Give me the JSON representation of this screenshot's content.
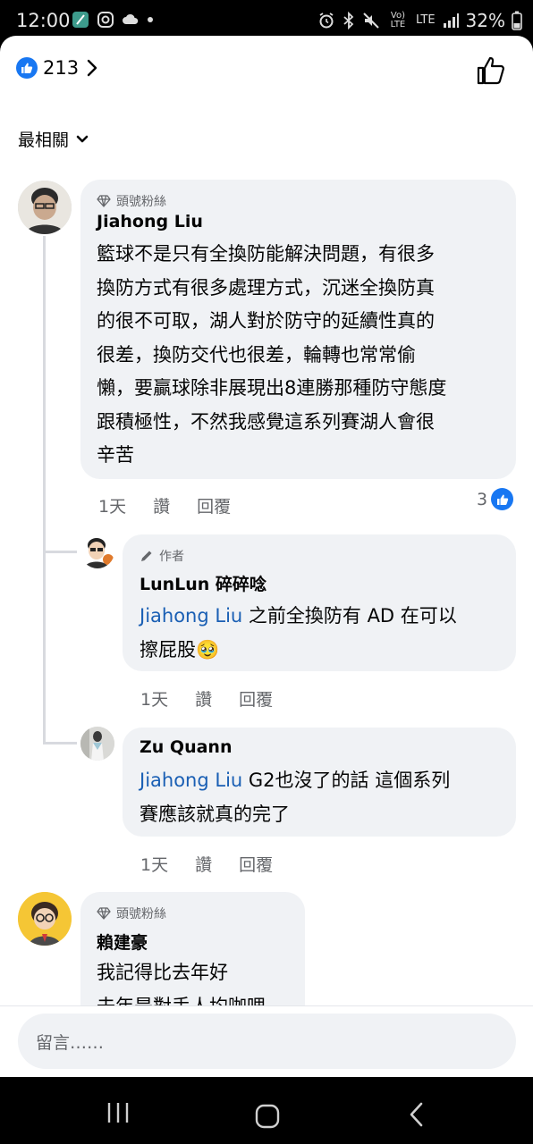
{
  "status_bar": {
    "time": "12:00",
    "battery": "32%",
    "volte": "Vo) LTE",
    "lte": "LTE"
  },
  "header": {
    "likes_count": "213"
  },
  "sort": {
    "label": "最相關"
  },
  "comments": [
    {
      "badge": "頭號粉絲",
      "author": "Jiahong Liu",
      "text_lines": [
        "籃球不是只有全換防能解決問題，有很多",
        "換防方式有很多處理方式，沉迷全換防真",
        "的很不可取，湖人對於防守的延續性真的",
        "很差，換防交代也很差，輪轉也常常偷",
        "懶，要贏球除非展現出8連勝那種防守態度",
        "跟積極性，不然我感覺這系列賽湖人會很",
        "辛苦"
      ],
      "time": "1天",
      "like": "讚",
      "reply": "回覆",
      "reactions": "3"
    },
    {
      "badge": "作者",
      "author": "LunLun 碎碎唸",
      "mention": "Jiahong Liu",
      "text_line1": " 之前全換防有 AD 在可以",
      "text_line2": "擦屁股🥹",
      "time": "1天",
      "like": "讚",
      "reply": "回覆"
    },
    {
      "author": "Zu Quann",
      "mention": "Jiahong Liu",
      "text_line1": " G2也沒了的話 這個系列",
      "text_line2": "賽應該就真的完了",
      "time": "1天",
      "like": "讚",
      "reply": "回覆"
    },
    {
      "badge": "頭號粉絲",
      "author": "賴建豪",
      "text_line1": "我記得比去年好",
      "text_line2": "去年是對手人均咖哩"
    }
  ],
  "composer": {
    "placeholder": "留言……"
  },
  "colors": {
    "accent": "#1877f2",
    "mention": "#1a5fb4",
    "bubble": "#f0f2f5",
    "muted": "#65676b"
  }
}
